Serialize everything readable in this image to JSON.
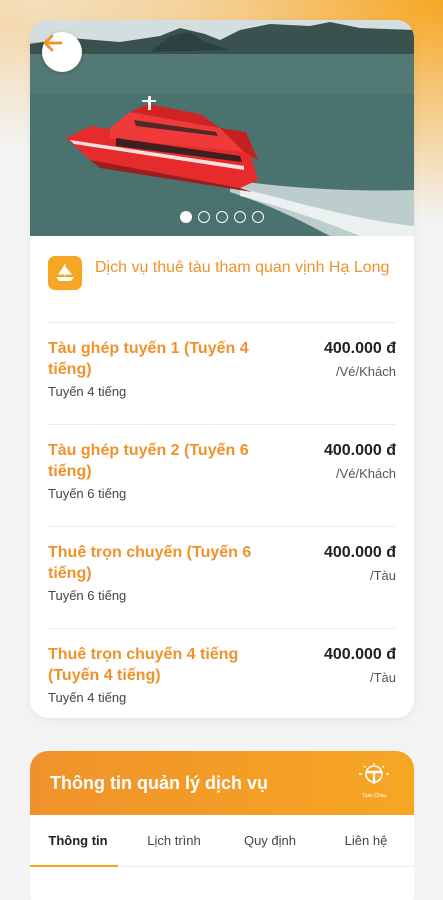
{
  "hero": {
    "back_icon": "arrow-left-icon",
    "carousel_count": 5,
    "carousel_active_index": 0
  },
  "service": {
    "icon": "boat-icon",
    "title": "Dịch vụ thuê tàu tham quan vịnh Hạ Long"
  },
  "items": [
    {
      "name": "Tàu ghép tuyến 1 (Tuyến 4 tiếng)",
      "sub": "Tuyến 4 tiếng",
      "price": "400.000 đ",
      "unit": "/Vé/Khách"
    },
    {
      "name": "Tàu ghép tuyến 2 (Tuyến 6 tiếng)",
      "sub": "Tuyến 6 tiếng",
      "price": "400.000 đ",
      "unit": "/Vé/Khách"
    },
    {
      "name": "Thuê trọn chuyến (Tuyến 6 tiếng)",
      "sub": "Tuyến 6 tiếng",
      "price": "400.000 đ",
      "unit": "/Tàu"
    },
    {
      "name": "Thuê trọn chuyến 4 tiếng (Tuyến 4 tiếng)",
      "sub": "Tuyến 4 tiếng",
      "price": "400.000 đ",
      "unit": "/Tàu"
    }
  ],
  "management": {
    "title": "Thông tin quản lý dịch vụ",
    "logo_text": "Tuan Chau",
    "tabs": [
      "Thông tin",
      "Lịch trình",
      "Quy định",
      "Liên hệ"
    ],
    "active_tab": 0
  },
  "colors": {
    "accent": "#f0922b",
    "accent_light": "#f6a623",
    "boat_red": "#e52b2b"
  }
}
